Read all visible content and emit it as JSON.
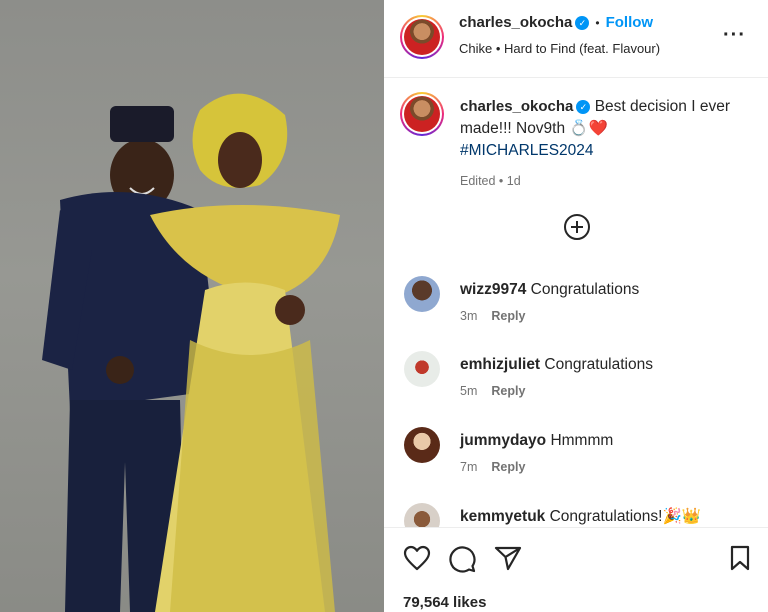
{
  "post": {
    "author": "charles_okocha",
    "follow_label": "Follow",
    "song": "Chike • Hard to Find (feat. Flavour)",
    "caption_text": "Best decision I ever made!!! Nov9th 💍❤️",
    "hashtag": "#MICHARLES2024",
    "edited": "Edited • 1d",
    "likes": "79,564 likes"
  },
  "comments": [
    {
      "user": "wizz9974",
      "text": "Congratulations",
      "time": "3m",
      "reply": "Reply"
    },
    {
      "user": "emhizjuliet",
      "text": "Congratulations",
      "time": "5m",
      "reply": "Reply"
    },
    {
      "user": "jummydayo",
      "text": "Hmmmm",
      "time": "7m",
      "reply": "Reply"
    },
    {
      "user": "kemmyetuk",
      "text": "Congratulations!🎉👑",
      "time": "",
      "reply": ""
    }
  ],
  "icons": {
    "more": "more-horizontal-icon",
    "add": "plus-circle-icon",
    "like": "heart-icon",
    "comment": "comment-icon",
    "share": "send-icon",
    "save": "bookmark-icon"
  },
  "colors": {
    "accent_blue": "#0095f6",
    "hashtag": "#00376b",
    "muted": "#737373",
    "dress_gold": "#d9c24a"
  }
}
